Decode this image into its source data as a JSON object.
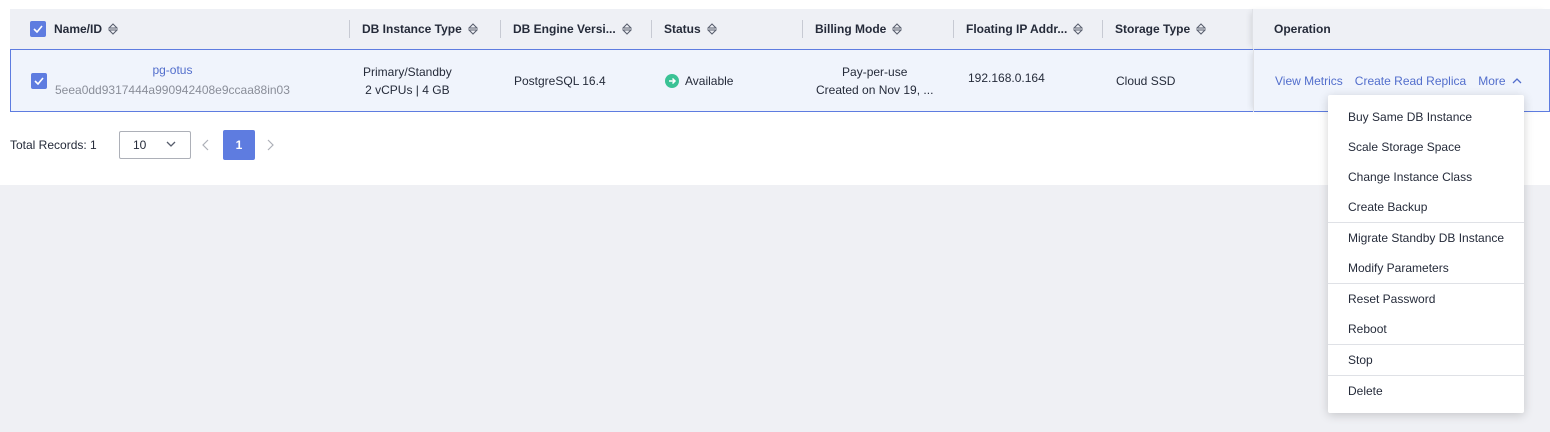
{
  "table": {
    "headers": {
      "name": "Name/ID",
      "type": "DB Instance Type",
      "engine": "DB Engine Versi...",
      "status": "Status",
      "billing": "Billing Mode",
      "ip": "Floating IP Addr...",
      "storage": "Storage Type",
      "operation": "Operation"
    },
    "row": {
      "name": "pg-otus",
      "id": "5eea0dd9317444a990942408e9ccaa88in03",
      "type_line1": "Primary/Standby",
      "type_line2": "2 vCPUs | 4 GB",
      "engine": "PostgreSQL 16.4",
      "status": "Available",
      "billing_line1": "Pay-per-use",
      "billing_line2": "Created on Nov 19, ...",
      "ip": "192.168.0.164",
      "storage": "Cloud SSD",
      "op_view_metrics": "View Metrics",
      "op_create_replica": "Create Read Replica",
      "op_more": "More"
    }
  },
  "pagination": {
    "total_label": "Total Records: 1",
    "page_size": "10",
    "current_page": "1"
  },
  "more_menu": {
    "items": [
      "Buy Same DB Instance",
      "Scale Storage Space",
      "Change Instance Class",
      "Create Backup",
      "Migrate Standby DB Instance",
      "Modify Parameters",
      "Reset Password",
      "Reboot",
      "Stop",
      "Delete"
    ]
  },
  "colors": {
    "accent": "#5e7ce0",
    "link": "#526ecc",
    "status_available": "#3ac295"
  }
}
